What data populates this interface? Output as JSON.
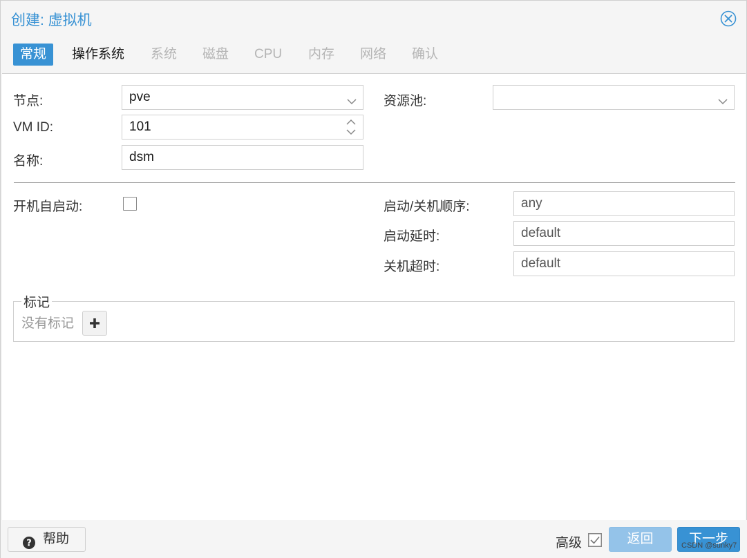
{
  "window": {
    "title": "创建: 虚拟机"
  },
  "tabs": [
    {
      "label": "常规",
      "state": "active"
    },
    {
      "label": "操作系统",
      "state": "enabled"
    },
    {
      "label": "系统",
      "state": "disabled"
    },
    {
      "label": "磁盘",
      "state": "disabled"
    },
    {
      "label": "CPU",
      "state": "disabled"
    },
    {
      "label": "内存",
      "state": "disabled"
    },
    {
      "label": "网络",
      "state": "disabled"
    },
    {
      "label": "确认",
      "state": "disabled"
    }
  ],
  "form": {
    "node_label": "节点:",
    "node_value": "pve",
    "vmid_label": "VM ID:",
    "vmid_value": "101",
    "name_label": "名称:",
    "name_value": "dsm",
    "pool_label": "资源池:",
    "pool_value": "",
    "onboot_label": "开机自启动:",
    "onboot_checked": false,
    "order_label": "启动/关机顺序:",
    "order_value": "any",
    "startup_delay_label": "启动延时:",
    "startup_delay_value": "default",
    "shutdown_timeout_label": "关机超时:",
    "shutdown_timeout_value": "default"
  },
  "tags": {
    "legend": "标记",
    "empty_text": "没有标记"
  },
  "footer": {
    "help_label": "帮助",
    "advanced_label": "高级",
    "advanced_checked": true,
    "back_label": "返回",
    "next_label": "下一步"
  },
  "watermark": "CSDN @sunky7",
  "colors": {
    "accent": "#3892d4",
    "accent_disabled": "#94c3e9"
  },
  "icons": {
    "close": "close-circle-icon",
    "combo": "chevron-down-icon",
    "spinner": "spinner-arrows-icon",
    "add": "plus-icon",
    "help": "question-circle-icon",
    "advanced": "checkbox-checked-icon"
  }
}
